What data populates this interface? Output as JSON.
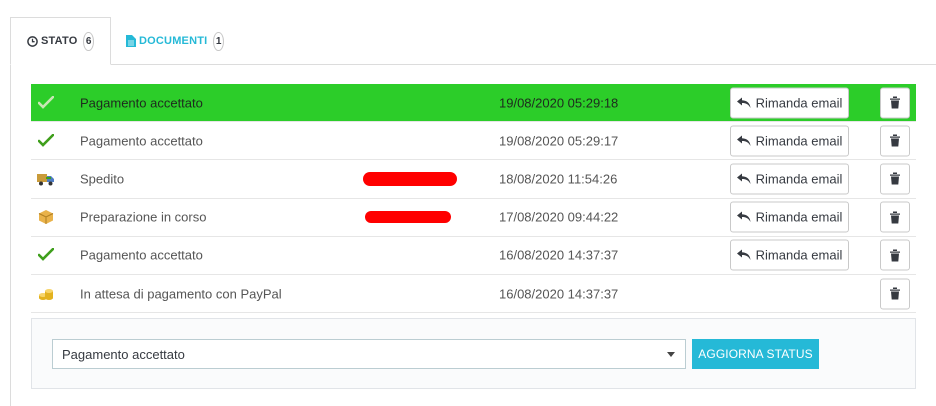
{
  "tabs": [
    {
      "label": "STATO",
      "count": "6",
      "icon": "clock-icon"
    },
    {
      "label": "DOCUMENTI",
      "count": "1",
      "icon": "document-icon"
    }
  ],
  "history": [
    {
      "status": "Pagamento accettato",
      "date": "19/08/2020 05:29:18",
      "icon": "check-icon",
      "resend_label": "Rimanda email",
      "highlight": true
    },
    {
      "status": "Pagamento accettato",
      "date": "19/08/2020 05:29:17",
      "icon": "check-icon",
      "resend_label": "Rimanda email"
    },
    {
      "status": "Spedito",
      "date": "18/08/2020 11:54:26",
      "icon": "truck-icon",
      "resend_label": "Rimanda email"
    },
    {
      "status": "Preparazione in corso",
      "date": "17/08/2020 09:44:22",
      "icon": "box-icon",
      "resend_label": "Rimanda email"
    },
    {
      "status": "Pagamento accettato",
      "date": "16/08/2020 14:37:37",
      "icon": "check-icon",
      "resend_label": "Rimanda email"
    },
    {
      "status": "In attesa di pagamento con PayPal",
      "date": "16/08/2020 14:37:37",
      "icon": "coins-icon"
    }
  ],
  "status_form": {
    "selected": "Pagamento accettato",
    "submit_label": "AGGIORNA STATUS"
  },
  "colors": {
    "accent": "#25b9d7",
    "highlight_row": "#2ccd29",
    "redaction": "#ff0000"
  }
}
